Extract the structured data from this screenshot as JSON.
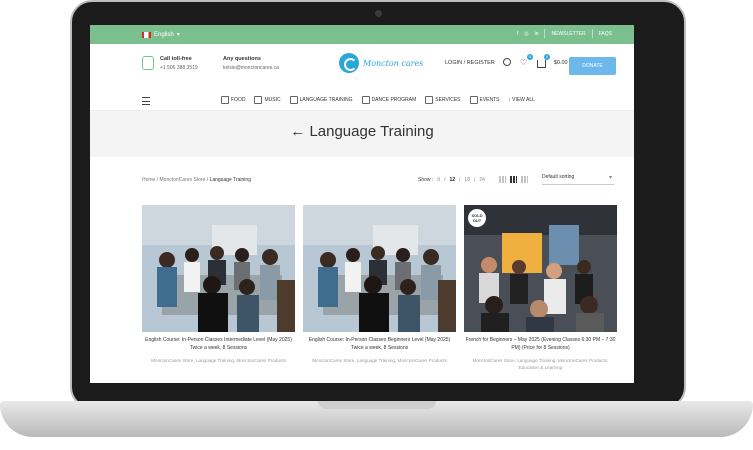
{
  "topbar": {
    "language": "English",
    "social": [
      "facebook-icon",
      "instagram-icon",
      "linkedin-icon"
    ],
    "newsletter": "NEWSLETTER",
    "faqs": "FAQS"
  },
  "header": {
    "call_title": "Call toll-free",
    "call_number": "+1 506 388 3519",
    "questions_title": "Any questions",
    "questions_email": "kelsie@monctoncares.ca",
    "logo_text": "Moncton cares",
    "login": "LOGIN / REGISTER",
    "wishlist_count": "0",
    "cart_count": "0",
    "cart_total": "$0.00",
    "donate": "DONATE"
  },
  "nav": {
    "items": [
      "FOOD",
      "MUSIC",
      "LANGUAGE TRAINING",
      "DANCE PROGRAM",
      "SERVICES",
      "EVENTS",
      "VIEW ALL"
    ]
  },
  "page": {
    "title": "Language Training",
    "breadcrumb": [
      "Home",
      "MonctonCares Store",
      "Language Training"
    ],
    "show_label": "Show :",
    "show_options": [
      "9",
      "12",
      "18",
      "24"
    ],
    "sorting": "Default sorting"
  },
  "products": [
    {
      "title": "English Course: In-Person Classes Intermediate Level (May 2025) Twice a week, 8 Sessions",
      "categories": "MonctonCares Store, Language Training, MonctonCares Products",
      "sold_out": false
    },
    {
      "title": "English Course: In-Person Classes Beginners Level (May 2025) Twice a week, 8 Sessions",
      "categories": "MonctonCares Store, Language Training, MonctonCares Products",
      "sold_out": false
    },
    {
      "title": "French for Beginners – May 2025 (Evening Classes 6:30 PM – 7:30 PM) (Price for 8 Sessions)",
      "categories": "MonctonCares Store, Language Training, MonctonCares Products, Education & Learning",
      "sold_out": true,
      "sold_out_label": "SOLD OUT"
    }
  ],
  "colors": {
    "topbar": "#7bbf8e",
    "brand": "#2aa7d9",
    "donate": "#6cb8ea"
  }
}
